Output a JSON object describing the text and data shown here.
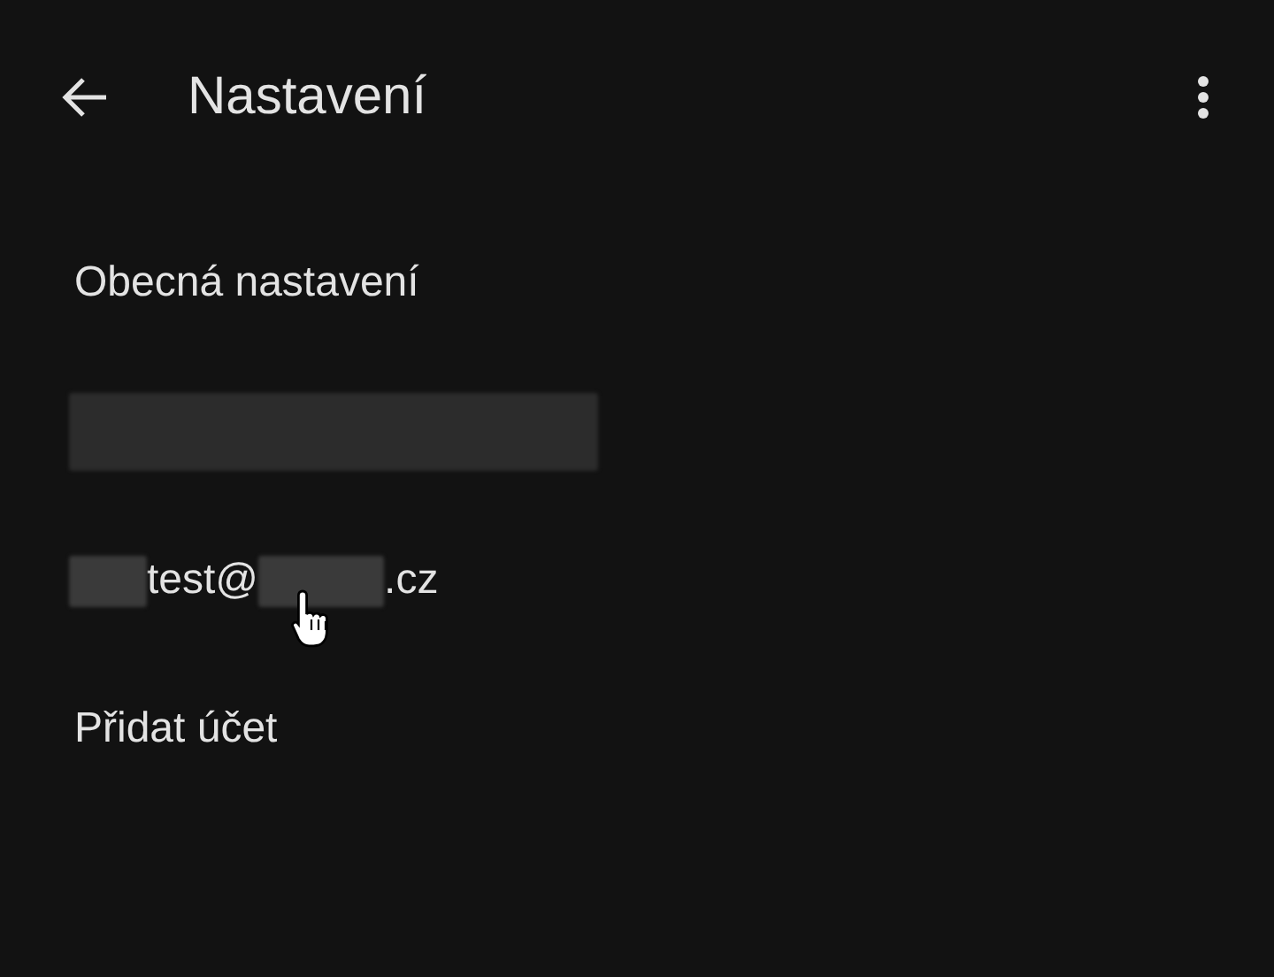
{
  "app_bar": {
    "title": "Nastavení"
  },
  "items": [
    {
      "kind": "text",
      "label": "Obecná nastavení"
    },
    {
      "kind": "redacted"
    },
    {
      "kind": "email",
      "parts": [
        {
          "kind": "redacted"
        },
        {
          "kind": "text",
          "text": "test@"
        },
        {
          "kind": "redacted"
        },
        {
          "kind": "text",
          "text": ".cz"
        }
      ]
    },
    {
      "kind": "text",
      "label": "Přidat účet"
    }
  ]
}
